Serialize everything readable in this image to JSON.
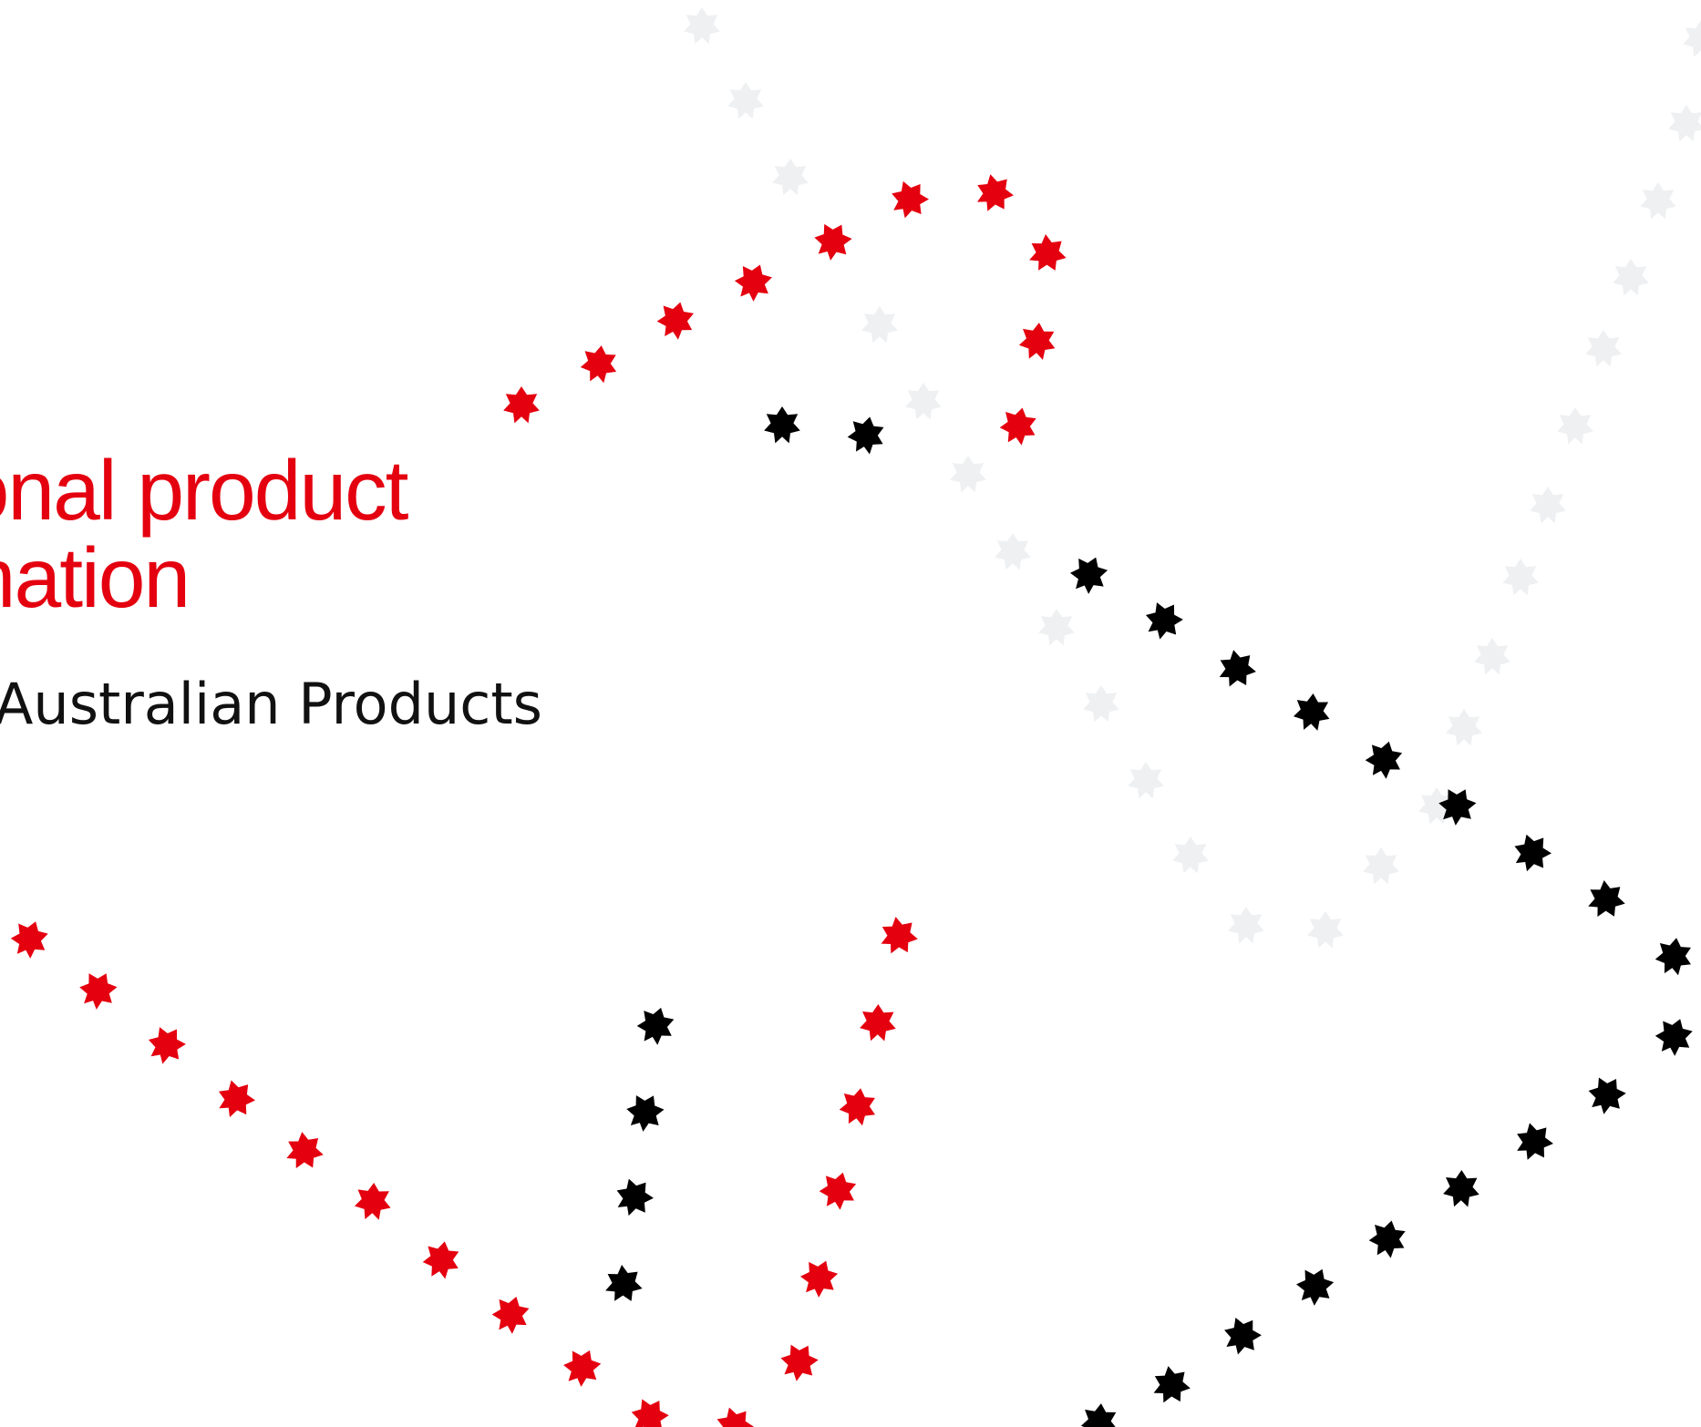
{
  "heading": {
    "line1": "ional product",
    "line2": "mation"
  },
  "subtitle": "Australian Products",
  "colors": {
    "accent_red": "#e4000f",
    "star_black": "#000000",
    "star_faint": "#eef0f2",
    "background": "#ffffff"
  },
  "decoration": {
    "icon": "seven-point-star-icon",
    "trails": [
      "red-star-trail",
      "black-star-trail",
      "faint-star-trail"
    ]
  }
}
